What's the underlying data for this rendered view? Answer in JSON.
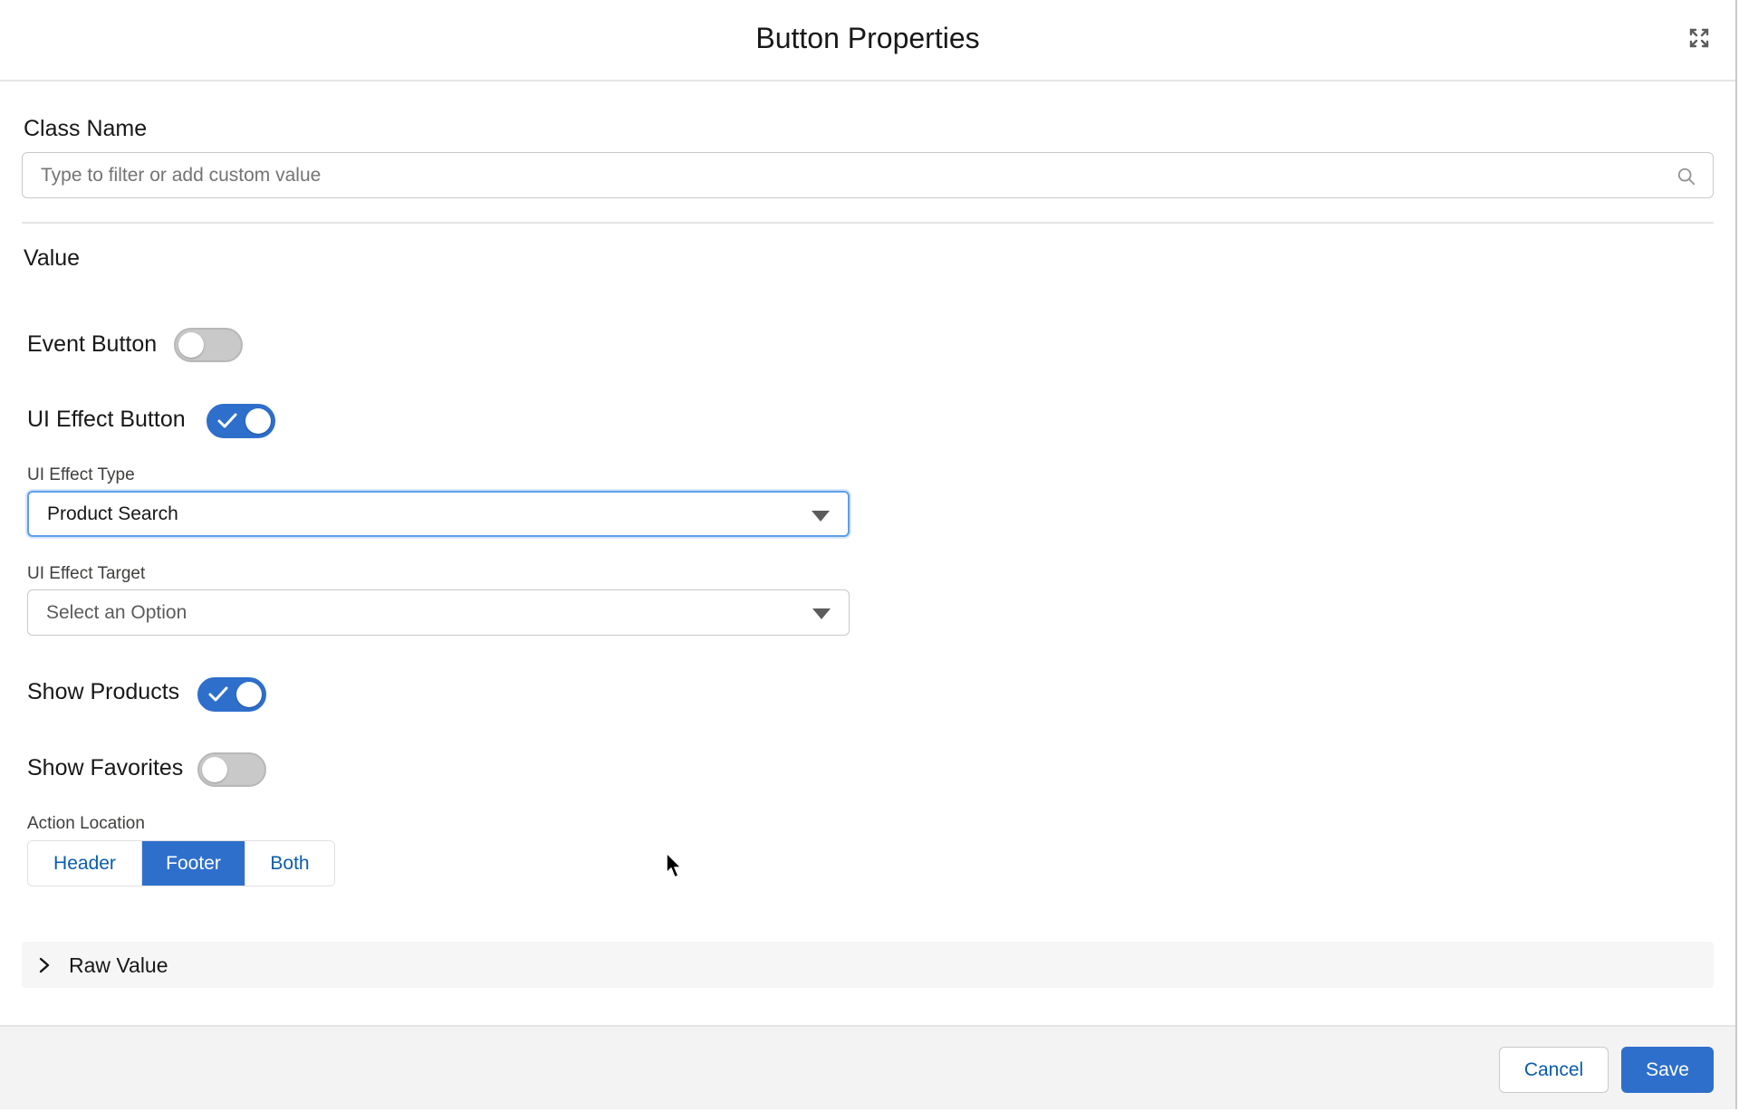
{
  "modal": {
    "title": "Button Properties"
  },
  "class_name": {
    "label": "Class Name",
    "placeholder": "Type to filter or add custom value",
    "value": ""
  },
  "value_section": {
    "heading": "Value"
  },
  "event_button": {
    "label": "Event Button",
    "checked": false
  },
  "ui_effect_button": {
    "label": "UI Effect Button",
    "checked": true
  },
  "ui_effect_type": {
    "label": "UI Effect Type",
    "selected": "Product Search"
  },
  "ui_effect_target": {
    "label": "UI Effect Target",
    "selected": "Select an Option"
  },
  "show_products": {
    "label": "Show Products",
    "checked": true
  },
  "show_favorites": {
    "label": "Show Favorites",
    "checked": false
  },
  "action_location": {
    "label": "Action Location",
    "options": [
      "Header",
      "Footer",
      "Both"
    ],
    "selected": "Footer"
  },
  "raw_value": {
    "label": "Raw Value"
  },
  "footer": {
    "cancel_label": "Cancel",
    "save_label": "Save"
  },
  "colors": {
    "brand": "#2e6fcc",
    "link": "#0b5cab",
    "toggle_off": "#c9c9c9"
  }
}
